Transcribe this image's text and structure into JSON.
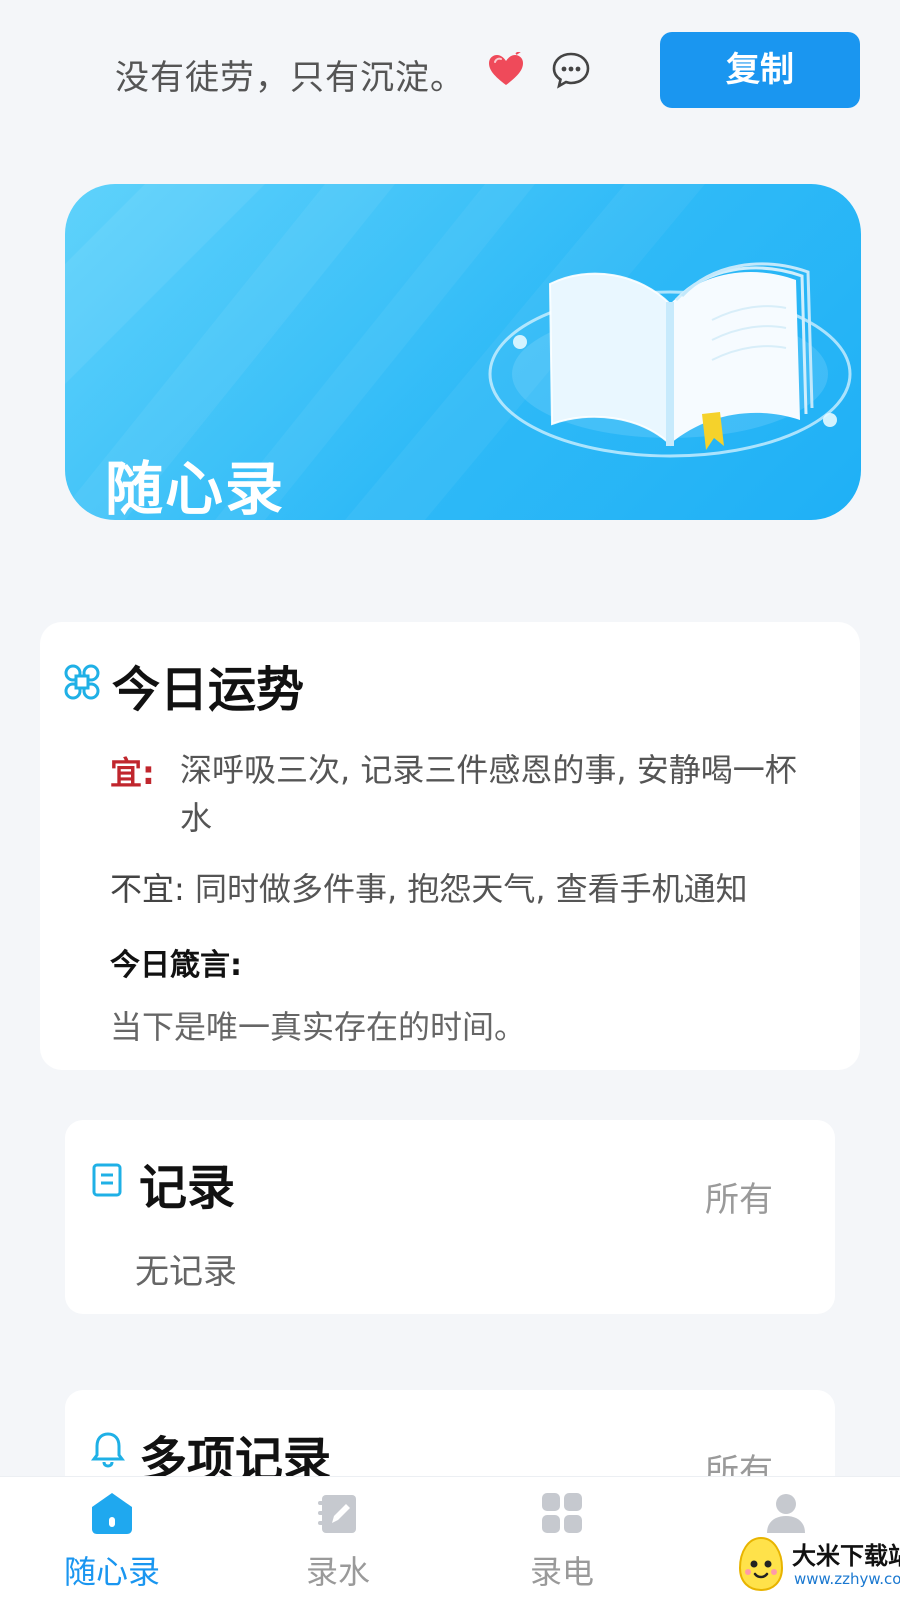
{
  "header": {
    "quote": "没有徒劳，只有沉淀。",
    "copy_label": "复制",
    "heart_icon": "heart-icon",
    "chat_icon": "chat-bubble-icon"
  },
  "banner": {
    "title": "随心录",
    "illustration": "open-book-illustration"
  },
  "fortune": {
    "title": "今日运势",
    "yi_label": "宜:",
    "yi_text": "深呼吸三次, 记录三件感恩的事, 安静喝一杯水",
    "buyi_label": "不宜:",
    "buyi_text": "同时做多件事, 抱怨天气, 查看手机通知",
    "motto_label": "今日箴言:",
    "motto_text": "当下是唯一真实存在的时间。"
  },
  "records": {
    "title": "记录",
    "all_label": "所有",
    "empty_text": "无记录"
  },
  "multi_records": {
    "title": "多项记录",
    "all_label": "所有"
  },
  "nav": {
    "items": [
      {
        "label": "随心录",
        "icon": "home-icon",
        "active": true
      },
      {
        "label": "录水",
        "icon": "notebook-pen-icon",
        "active": false
      },
      {
        "label": "录电",
        "icon": "grid-icon",
        "active": false
      },
      {
        "label": "",
        "icon": "user-icon",
        "active": false
      }
    ]
  },
  "watermark": {
    "title": "大米下载站",
    "url": "www.zzhyw.com"
  },
  "colors": {
    "accent": "#1a96f0",
    "yi_red": "#c0262d",
    "banner_blue": "#2fbaf7",
    "page_bg": "#f4f6f9"
  }
}
